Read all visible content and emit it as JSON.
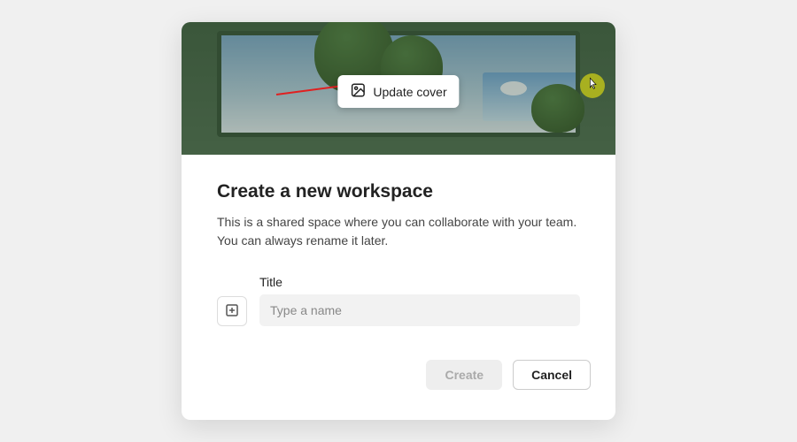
{
  "cover": {
    "update_label": "Update cover"
  },
  "dialog": {
    "title": "Create a new workspace",
    "subtitle_line1": "This is a shared space where you can collaborate with your team.",
    "subtitle_line2": "You can always rename it later."
  },
  "form": {
    "title_label": "Title",
    "title_placeholder": "Type a name",
    "title_value": ""
  },
  "actions": {
    "create_label": "Create",
    "cancel_label": "Cancel"
  }
}
